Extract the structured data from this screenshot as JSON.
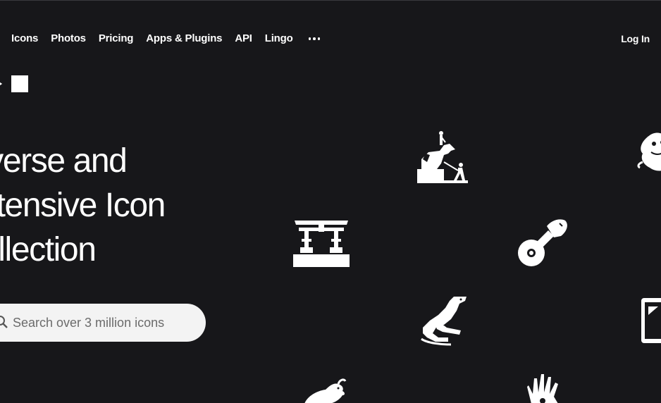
{
  "nav": {
    "items": [
      {
        "label": "Icons"
      },
      {
        "label": "Photos"
      },
      {
        "label": "Pricing"
      },
      {
        "label": "Apps & Plugins"
      },
      {
        "label": "API"
      },
      {
        "label": "Lingo"
      }
    ],
    "more_icon": "more-horizontal-icon",
    "login_label": "Log In"
  },
  "hero": {
    "title_lines": [
      "iverse and",
      "xtensive Icon",
      "ollection"
    ]
  },
  "search": {
    "placeholder": "Search over 3 million icons",
    "icon": "search-icon"
  },
  "showcase_icons": [
    "statue-icon",
    "dragon-icon",
    "torii-gate-icon",
    "pizza-cutter-icon",
    "lizard-icon",
    "tablet-icon",
    "quail-icon",
    "hand-icon"
  ],
  "colors": {
    "background": "#17171a",
    "text": "#ffffff",
    "search_bg": "#f3f3f3"
  }
}
